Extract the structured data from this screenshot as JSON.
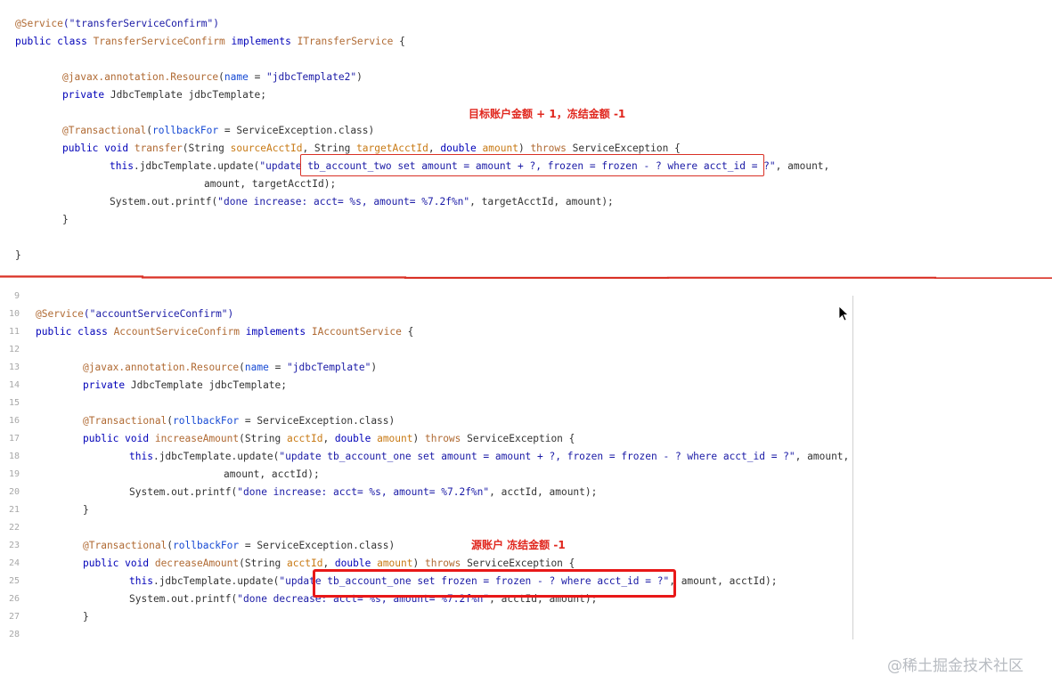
{
  "top_code": {
    "line1": {
      "annotation": "@Service",
      "arg": "(\"transferServiceConfirm\")"
    },
    "line2": {
      "kw1": "public class ",
      "cls": "TransferServiceConfirm",
      "kw2": " implements ",
      "iface": "ITransferService",
      "rest": " {"
    },
    "line3": {
      "annotation": "@javax.annotation.Resource",
      "p1": "(",
      "attr": "name",
      "p2": " = ",
      "str": "\"jdbcTemplate2\"",
      "p3": ")"
    },
    "line4": {
      "kw": "private ",
      "rest": "JdbcTemplate jdbcTemplate;"
    },
    "line5": {
      "annotation": "@Transactional",
      "p1": "(",
      "attr": "rollbackFor",
      "p2": " = ServiceException.class)"
    },
    "line6": {
      "kw": "public void ",
      "meth": "transfer",
      "p1": "(String ",
      "a1": "sourceAcctId",
      "p2": ", String ",
      "a2": "targetAcctId",
      "p3": ", ",
      "kw2": "double ",
      "a3": "amount",
      "p4": ") ",
      "kw3": "throws",
      "p5": " ServiceException {"
    },
    "line7": {
      "this": "this",
      "p1": ".jdbcTemplate.update(",
      "str": "\"update tb_account_two set amount = amount + ?, frozen = frozen - ? where acct_id = ?\"",
      "p2": ", amount,"
    },
    "line8": "amount, targetAcctId);",
    "line9": {
      "p1": "System.out.printf(",
      "str": "\"done increase: acct= %s, amount= %7.2f%n\"",
      "p2": ", targetAcctId, amount);"
    },
    "line10": "}",
    "line11": "}"
  },
  "top_note": "目标账户金额 + 1，冻结金额 -1",
  "bottom_code": {
    "line_numbers": [
      "9",
      "10",
      "11",
      "12",
      "13",
      "14",
      "15",
      "16",
      "17",
      "18",
      "19",
      "20",
      "21",
      "22",
      "23",
      "24",
      "25",
      "26",
      "27",
      "28"
    ],
    "l10": {
      "annotation": "@Service",
      "arg": "(\"accountServiceConfirm\")"
    },
    "l11": {
      "kw1": "public class ",
      "cls": "AccountServiceConfirm",
      "kw2": " implements ",
      "iface": "IAccountService",
      "rest": " {"
    },
    "l13": {
      "annotation": "@javax.annotation.Resource",
      "p1": "(",
      "attr": "name",
      "p2": " = ",
      "str": "\"jdbcTemplate\"",
      "p3": ")"
    },
    "l14": {
      "kw": "private ",
      "rest": "JdbcTemplate jdbcTemplate;"
    },
    "l16": {
      "annotation": "@Transactional",
      "p1": "(",
      "attr": "rollbackFor",
      "p2": " = ServiceException.class)"
    },
    "l17": {
      "kw": "public void ",
      "meth": "increaseAmount",
      "p1": "(String ",
      "a1": "acctId",
      "p2": ", ",
      "kw2": "double ",
      "a2": "amount",
      "p3": ") ",
      "kw3": "throws",
      "p4": " ServiceException {"
    },
    "l18": {
      "this": "this",
      "p1": ".jdbcTemplate.update(",
      "str": "\"update tb_account_one set amount = amount + ?, frozen = frozen - ? where acct_id = ?\"",
      "p2": ", amount,"
    },
    "l19": "amount, acctId);",
    "l20": {
      "p1": "System.out.printf(",
      "str": "\"done increase: acct= %s, amount= %7.2f%n\"",
      "p2": ", acctId, amount);"
    },
    "l21": "}",
    "l23": {
      "annotation": "@Transactional",
      "p1": "(",
      "attr": "rollbackFor",
      "p2": " = ServiceException.class)"
    },
    "l24": {
      "kw": "public void ",
      "meth": "decreaseAmount",
      "p1": "(String ",
      "a1": "acctId",
      "p2": ", ",
      "kw2": "double ",
      "a2": "amount",
      "p3": ") ",
      "kw3": "throws",
      "p4": " ServiceException {"
    },
    "l25": {
      "this": "this",
      "p1": ".jdbcTemplate.update(",
      "str": "\"update tb_account_one set frozen = frozen - ? where acct_id = ?\"",
      "p2": ", amount, acctId);"
    },
    "l26": {
      "p1": "System.out.printf(",
      "str": "\"done decrease: acct= %s, amount= %7.2f%n\"",
      "p2": ", acctId, amount);"
    },
    "l27": "}"
  },
  "bottom_note": "源账户 冻结金额 -1",
  "watermark": "@稀土掘金技术社区",
  "colors": {
    "highlight": "#e81818",
    "note": "#e0261d",
    "keyword": "#0000b8"
  }
}
